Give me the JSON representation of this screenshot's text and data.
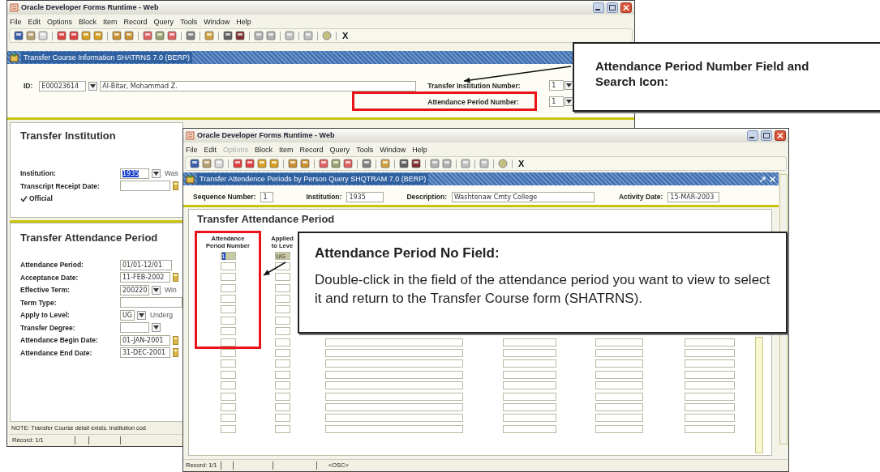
{
  "back_window": {
    "title": "Oracle Developer Forms Runtime - Web",
    "menu": [
      {
        "label": "File",
        "disabled": false
      },
      {
        "label": "Edit",
        "disabled": false
      },
      {
        "label": "Options",
        "disabled": false
      },
      {
        "label": "Block",
        "disabled": false
      },
      {
        "label": "Item",
        "disabled": false
      },
      {
        "label": "Record",
        "disabled": false
      },
      {
        "label": "Query",
        "disabled": false
      },
      {
        "label": "Tools",
        "disabled": false
      },
      {
        "label": "Window",
        "disabled": false
      },
      {
        "label": "Help",
        "disabled": false
      }
    ],
    "toolbar_exit": "X",
    "form_title": "Transfer Course Information  SHATRNS  7.0  (BERP)",
    "key_block": {
      "id_label": "ID:",
      "id_value": "E00023614",
      "name_value": "Al-Bitar, Mohammad Z.",
      "fields": [
        {
          "label": "Transfer Institution Number:",
          "value": "1"
        },
        {
          "label": "Attendance Period Number:",
          "value": "1"
        }
      ]
    },
    "institution_section": {
      "heading": "Transfer Institution",
      "fields": [
        {
          "label": "Institution:",
          "value": "1935",
          "selected": true,
          "kind": "lov",
          "description": "Was"
        },
        {
          "label": "Transcript Receipt Date:",
          "kind": "date"
        }
      ],
      "official": {
        "label": "Official",
        "checked": true
      }
    },
    "period_section": {
      "heading": "Transfer Attendance Period",
      "fields": [
        {
          "label": "Attendance Period:",
          "value": "01/01-12/01",
          "kind": "text"
        },
        {
          "label": "Acceptance Date:",
          "value": "11-FEB-2002",
          "kind": "date"
        },
        {
          "label": "Effective Term:",
          "value": "200220",
          "kind": "lov",
          "description": "Win"
        },
        {
          "label": "Term Type:",
          "kind": "wide"
        },
        {
          "label": "Apply to Level:",
          "value": "UG",
          "kind": "lov",
          "description": "Underg"
        },
        {
          "label": "Transfer Degree:",
          "kind": "lov"
        },
        {
          "label": "Attendance Begin Date:",
          "value": "01-JAN-2001",
          "kind": "date"
        },
        {
          "label": "Attendance End Date:",
          "value": "31-DEC-2001",
          "kind": "date"
        }
      ]
    },
    "note": "NOTE: Transfer Course detail exists. Institution cod",
    "status_bar": [
      "Record: 1/1"
    ]
  },
  "front_window": {
    "title": "Oracle Developer Forms Runtime - Web",
    "menu": [
      {
        "label": "File",
        "disabled": false
      },
      {
        "label": "Edit",
        "disabled": false
      },
      {
        "label": "Options",
        "disabled": true
      },
      {
        "label": "Block",
        "disabled": false
      },
      {
        "label": "Item",
        "disabled": false
      },
      {
        "label": "Record",
        "disabled": false
      },
      {
        "label": "Query",
        "disabled": false
      },
      {
        "label": "Tools",
        "disabled": false
      },
      {
        "label": "Window",
        "disabled": false
      },
      {
        "label": "Help",
        "disabled": false
      }
    ],
    "toolbar_exit": "X",
    "form_title": "Transfer Attendence Periods by Person Query  SHQTRAM  7.0  (BERP)",
    "key_fields": [
      {
        "label": "Sequence Number:",
        "value": "1"
      },
      {
        "label": "Institution:",
        "value": "1935"
      },
      {
        "label": "Description:",
        "value": "Washtenaw Cmty College"
      },
      {
        "label": "Activity Date:",
        "value": "15-MAR-2003"
      }
    ],
    "section_heading": "Transfer Attendance Period",
    "grid": {
      "columns": [
        {
          "heading": "Attendance Period Number"
        },
        {
          "heading": "Applied to Leve"
        }
      ],
      "rows": [
        {
          "period_number": "1",
          "level": "UG",
          "selected": true
        },
        {
          "selected": false
        },
        {
          "selected": false
        },
        {
          "selected": false
        },
        {
          "selected": false
        },
        {
          "selected": false
        },
        {
          "selected": false
        },
        {
          "selected": false
        },
        {
          "selected": false
        },
        {
          "selected": false
        },
        {
          "selected": false
        },
        {
          "selected": false
        },
        {
          "selected": false
        },
        {
          "selected": false
        },
        {
          "selected": false
        },
        {
          "selected": false
        },
        {
          "selected": false
        }
      ]
    },
    "status_bar": [
      "Record: 1/1",
      "<OSC>"
    ]
  },
  "callouts": [
    {
      "heading": "Attendance Period Number Field and Search Icon:"
    },
    {
      "heading": "Attendance Period No Field:",
      "body": "Double-click in the field of the attendance period you want to view to select it and return to the Transfer Course form (SHATRNS)."
    }
  ]
}
